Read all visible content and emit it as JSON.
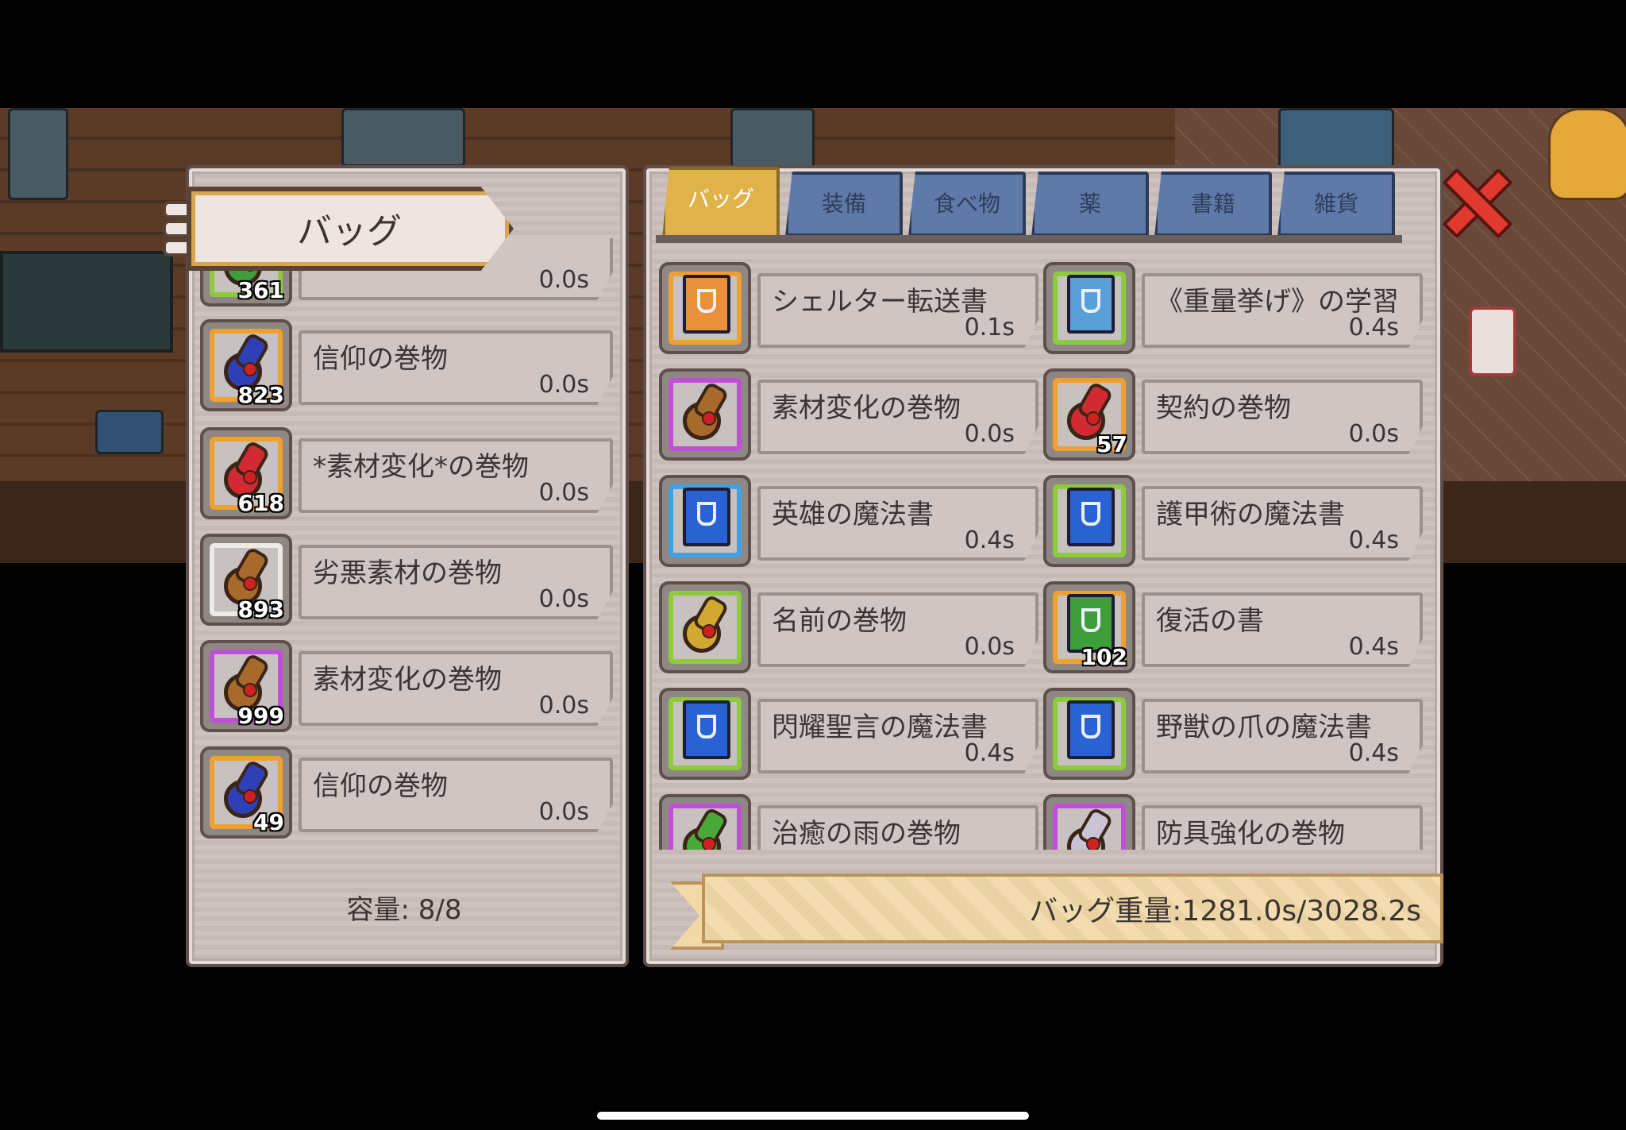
{
  "left_panel": {
    "title": "バッグ",
    "items": [
      {
        "name": "",
        "count": "361",
        "weight": "0.0s",
        "icon": "scroll-icon",
        "rarity": "green",
        "color": "#3d9e3a"
      },
      {
        "name": "信仰の巻物",
        "count": "823",
        "weight": "0.0s",
        "icon": "scroll-icon",
        "rarity": "orange",
        "color": "#2f3fb5"
      },
      {
        "name": "*素材変化*の巻物",
        "count": "618",
        "weight": "0.0s",
        "icon": "scroll-icon",
        "rarity": "orange",
        "color": "#d12a33"
      },
      {
        "name": "劣悪素材の巻物",
        "count": "893",
        "weight": "0.0s",
        "icon": "scroll-icon",
        "rarity": "white",
        "color": "#a86a2c"
      },
      {
        "name": "素材変化の巻物",
        "count": "999",
        "weight": "0.0s",
        "icon": "scroll-icon",
        "rarity": "purple",
        "color": "#a86a2c"
      },
      {
        "name": "信仰の巻物",
        "count": "49",
        "weight": "0.0s",
        "icon": "scroll-icon",
        "rarity": "orange",
        "color": "#2f3fb5"
      }
    ],
    "capacity": "容量: 8/8"
  },
  "tabs": [
    "バッグ",
    "装備",
    "食べ物",
    "薬",
    "書籍",
    "雑貨"
  ],
  "active_tab": "バッグ",
  "grid_items": [
    {
      "name": "シェルター転送書",
      "weight": "0.1s",
      "count": "",
      "icon": "book-icon",
      "rarity": "orange",
      "color": "#e8903a"
    },
    {
      "name": "《重量挙げ》の学習",
      "weight": "0.4s",
      "count": "",
      "icon": "book-icon",
      "rarity": "green",
      "color": "#5aa0d8"
    },
    {
      "name": "素材変化の巻物",
      "weight": "0.0s",
      "count": "",
      "icon": "scroll-icon",
      "rarity": "purple",
      "color": "#a86a2c"
    },
    {
      "name": "契約の巻物",
      "weight": "0.0s",
      "count": "57",
      "icon": "scroll-icon",
      "rarity": "orange",
      "color": "#d12a33"
    },
    {
      "name": "英雄の魔法書",
      "weight": "0.4s",
      "count": "",
      "icon": "book-icon",
      "rarity": "blue",
      "color": "#2a62d1"
    },
    {
      "name": "護甲術の魔法書",
      "weight": "0.4s",
      "count": "",
      "icon": "book-icon",
      "rarity": "green",
      "color": "#2a62d1"
    },
    {
      "name": "名前の巻物",
      "weight": "0.0s",
      "count": "",
      "icon": "scroll-icon",
      "rarity": "green",
      "color": "#d1a830"
    },
    {
      "name": "復活の書",
      "weight": "0.4s",
      "count": "102",
      "icon": "book-icon",
      "rarity": "orange",
      "color": "#3d9e3a"
    },
    {
      "name": "閃耀聖言の魔法書",
      "weight": "0.4s",
      "count": "",
      "icon": "book-icon",
      "rarity": "green",
      "color": "#2a62d1"
    },
    {
      "name": "野獣の爪の魔法書",
      "weight": "0.4s",
      "count": "",
      "icon": "book-icon",
      "rarity": "green",
      "color": "#2a62d1"
    },
    {
      "name": "治癒の雨の巻物",
      "weight": "",
      "count": "",
      "icon": "scroll-icon",
      "rarity": "purple",
      "color": "#4aa838"
    },
    {
      "name": "防具強化の巻物",
      "weight": "",
      "count": "",
      "icon": "scroll-icon",
      "rarity": "purple",
      "color": "#c9c3d6"
    }
  ],
  "bag_weight": "バッグ重量:1281.0s/3028.2s",
  "close_icon": "close-icon"
}
